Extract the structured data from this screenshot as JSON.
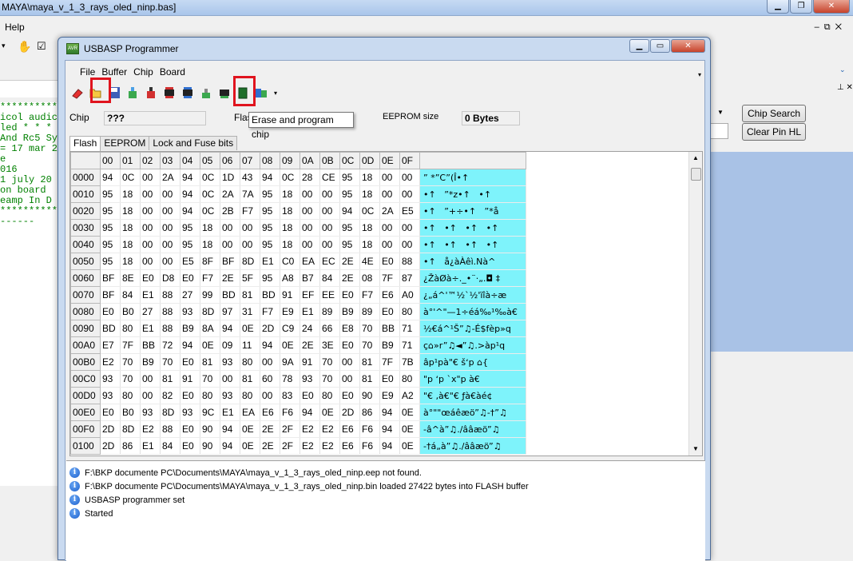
{
  "background": {
    "title": "MAYA\\maya_v_1_3_rays_oled_ninp.bas]",
    "menu_help": "Help",
    "code_lines": [
      "************",
      "icol audic",
      "led * * *",
      "And Rc5 Sy",
      "= 17 mar 2",
      "",
      "e",
      "016",
      "1 july 20",
      "",
      "",
      "on board",
      "eamp In D",
      "***********",
      "",
      "",
      "",
      "",
      "",
      "",
      "",
      "",
      "",
      "",
      "",
      "",
      "",
      "",
      "",
      "",
      "",
      "",
      "------"
    ],
    "chip_search_label": "Chip Search",
    "clear_pin_label": "Clear Pin HL"
  },
  "dialog": {
    "title": "USBASP Programmer",
    "menu": [
      "File",
      "Buffer",
      "Chip",
      "Board"
    ],
    "toolbar_icons": [
      "eraser-icon",
      "open-folder-icon",
      "save-icon",
      "read-flash-icon",
      "write-flash-icon",
      "read-chip-icon",
      "write-chip-icon",
      "verify-icon",
      "lock-icon",
      "erase-program-icon",
      "auto-icon"
    ],
    "chip_label": "Chip",
    "chip_value": "???",
    "flash_label": "Flas",
    "eeprom_size_label": "EEPROM size",
    "eeprom_size_value": "0 Bytes",
    "tooltip": "Erase and program chip",
    "tabs": [
      "Flash",
      "EEPROM",
      "Lock and Fuse bits"
    ],
    "active_tab": "Flash"
  },
  "hex": {
    "columns": [
      "00",
      "01",
      "02",
      "03",
      "04",
      "05",
      "06",
      "07",
      "08",
      "09",
      "0A",
      "0B",
      "0C",
      "0D",
      "0E",
      "0F"
    ],
    "rows": [
      {
        "addr": "0000",
        "bytes": [
          "94",
          "0C",
          "00",
          "2A",
          "94",
          "0C",
          "1D",
          "43",
          "94",
          "0C",
          "28",
          "CE",
          "95",
          "18",
          "00",
          "00"
        ],
        "ascii": "”\f *”\fC”(Î•↑"
      },
      {
        "addr": "0010",
        "bytes": [
          "95",
          "18",
          "00",
          "00",
          "94",
          "0C",
          "2A",
          "7A",
          "95",
          "18",
          "00",
          "00",
          "95",
          "18",
          "00",
          "00"
        ],
        "ascii": "•↑   ”\f*z•↑   •↑"
      },
      {
        "addr": "0020",
        "bytes": [
          "95",
          "18",
          "00",
          "00",
          "94",
          "0C",
          "2B",
          "F7",
          "95",
          "18",
          "00",
          "00",
          "94",
          "0C",
          "2A",
          "E5"
        ],
        "ascii": "•↑   ”\f+÷•↑   ”\f*å"
      },
      {
        "addr": "0030",
        "bytes": [
          "95",
          "18",
          "00",
          "00",
          "95",
          "18",
          "00",
          "00",
          "95",
          "18",
          "00",
          "00",
          "95",
          "18",
          "00",
          "00"
        ],
        "ascii": "•↑   •↑   •↑   •↑"
      },
      {
        "addr": "0040",
        "bytes": [
          "95",
          "18",
          "00",
          "00",
          "95",
          "18",
          "00",
          "00",
          "95",
          "18",
          "00",
          "00",
          "95",
          "18",
          "00",
          "00"
        ],
        "ascii": "•↑   •↑   •↑   •↑"
      },
      {
        "addr": "0050",
        "bytes": [
          "95",
          "18",
          "00",
          "00",
          "E5",
          "8F",
          "BF",
          "8D",
          "E1",
          "C0",
          "EA",
          "EC",
          "2E",
          "4E",
          "E0",
          "88"
        ],
        "ascii": "•↑   å¿àÀêì.Nà^"
      },
      {
        "addr": "0060",
        "bytes": [
          "BF",
          "8E",
          "E0",
          "D8",
          "E0",
          "F7",
          "2E",
          "5F",
          "95",
          "A8",
          "B7",
          "84",
          "2E",
          "08",
          "7F",
          "87"
        ],
        "ascii": "¿ŽàØà÷._•¨·„.◘ ‡"
      },
      {
        "addr": "0070",
        "bytes": [
          "BF",
          "84",
          "E1",
          "88",
          "27",
          "99",
          "BD",
          "81",
          "BD",
          "91",
          "EF",
          "EE",
          "E0",
          "F7",
          "E6",
          "A0"
        ],
        "ascii": "¿„á^'™½`½'ïîà÷æ"
      },
      {
        "addr": "0080",
        "bytes": [
          "E0",
          "B0",
          "27",
          "88",
          "93",
          "8D",
          "97",
          "31",
          "F7",
          "E9",
          "E1",
          "89",
          "B9",
          "89",
          "E0",
          "80"
        ],
        "ascii": "à°'^\"—1÷éá‰¹‰à€"
      },
      {
        "addr": "0090",
        "bytes": [
          "BD",
          "80",
          "E1",
          "88",
          "B9",
          "8A",
          "94",
          "0E",
          "2D",
          "C9",
          "24",
          "66",
          "E8",
          "70",
          "BB",
          "71"
        ],
        "ascii": "½€á^¹Š”♫-É$fèp»q"
      },
      {
        "addr": "00A0",
        "bytes": [
          "E7",
          "7F",
          "BB",
          "72",
          "94",
          "0E",
          "09",
          "11",
          "94",
          "0E",
          "2E",
          "3E",
          "E0",
          "70",
          "B9",
          "71"
        ],
        "ascii": "ç⌂»r”♫◄”♫.>àp¹q"
      },
      {
        "addr": "00B0",
        "bytes": [
          "E2",
          "70",
          "B9",
          "70",
          "E0",
          "81",
          "93",
          "80",
          "00",
          "9A",
          "91",
          "70",
          "00",
          "81",
          "7F",
          "7B"
        ],
        "ascii": "âp¹pà\"€ šʻp ⌂{"
      },
      {
        "addr": "00C0",
        "bytes": [
          "93",
          "70",
          "00",
          "81",
          "91",
          "70",
          "00",
          "81",
          "60",
          "78",
          "93",
          "70",
          "00",
          "81",
          "E0",
          "80"
        ],
        "ascii": "\"p ʻp `x\"p à€"
      },
      {
        "addr": "00D0",
        "bytes": [
          "93",
          "80",
          "00",
          "82",
          "E0",
          "80",
          "93",
          "80",
          "00",
          "83",
          "E0",
          "80",
          "E0",
          "90",
          "E9",
          "A2"
        ],
        "ascii": "\"€ ‚à€\"€ ƒà€àé¢"
      },
      {
        "addr": "00E0",
        "bytes": [
          "E0",
          "B0",
          "93",
          "8D",
          "93",
          "9C",
          "E1",
          "EA",
          "E6",
          "F6",
          "94",
          "0E",
          "2D",
          "86",
          "94",
          "0E"
        ],
        "ascii": "à°\"\"œáêæö”♫-†”♫"
      },
      {
        "addr": "00F0",
        "bytes": [
          "2D",
          "8D",
          "E2",
          "88",
          "E0",
          "90",
          "94",
          "0E",
          "2E",
          "2F",
          "E2",
          "E2",
          "E6",
          "F6",
          "94",
          "0E"
        ],
        "ascii": "-â^à”♫./ââæö”♫"
      },
      {
        "addr": "0100",
        "bytes": [
          "2D",
          "86",
          "E1",
          "84",
          "E0",
          "90",
          "94",
          "0E",
          "2E",
          "2F",
          "E2",
          "E2",
          "E6",
          "F6",
          "94",
          "0E"
        ],
        "ascii": "-†á„à”♫./ââæö”♫"
      }
    ]
  },
  "log": [
    "F:\\BKP documente PC\\Documents\\MAYA\\maya_v_1_3_rays_oled_ninp.eep not found.",
    "F:\\BKP documente PC\\Documents\\MAYA\\maya_v_1_3_rays_oled_ninp.bin loaded 27422 bytes into FLASH buffer",
    "USBASP programmer set",
    "Started"
  ]
}
